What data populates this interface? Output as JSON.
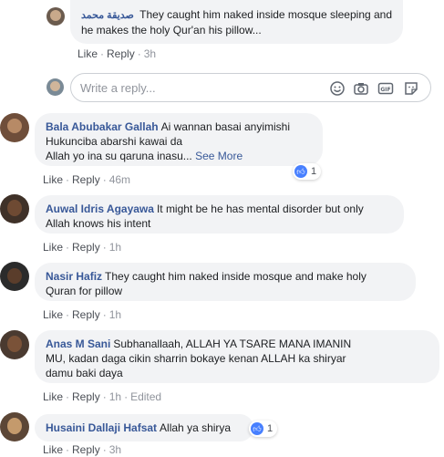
{
  "top_reply": {
    "author": "صديقة محمد",
    "text": "They caught him naked inside mosque sleeping and he makes the holy Qur'an his pillow...",
    "like": "Like",
    "reply": "Reply",
    "time": "3h"
  },
  "composer": {
    "placeholder": "Write a reply...",
    "icons": [
      "emoji-icon",
      "camera-icon",
      "gif-icon",
      "sticker-icon"
    ]
  },
  "comments": [
    {
      "author": "Bala Abubakar Gallah",
      "line1": "Ai wannan basai anyimishi",
      "line2": "Hukunciba abarshi kawai da",
      "line3": "Allah yo ina su qaruna inasu...",
      "see_more": "See More",
      "like": "Like",
      "reply": "Reply",
      "time": "46m",
      "reactions": "1"
    },
    {
      "author": "Auwal Idris Agayawa",
      "line1": "It might be he has mental disorder but only",
      "line2": "Allah knows his intent",
      "like": "Like",
      "reply": "Reply",
      "time": "1h"
    },
    {
      "author": "Nasir Hafiz",
      "line1": "They caught him naked inside mosque and make holy",
      "line2": "Quran for pillow",
      "like": "Like",
      "reply": "Reply",
      "time": "1h"
    },
    {
      "author": "Anas M Sani",
      "line1": "Subhanallaah, ALLAH YA TSARE MANA IMANIN",
      "line2": "MU, kadan daga cikin sharrin bokaye kenan ALLAH ka shiryar",
      "line3": "damu baki daya",
      "like": "Like",
      "reply": "Reply",
      "time": "1h",
      "edited": "Edited"
    },
    {
      "author": "Husaini Dallaji Hafsat",
      "line1": "Allah ya shirya",
      "like": "Like",
      "reply": "Reply",
      "time": "3h",
      "reactions": "1"
    }
  ],
  "colors": {
    "link": "#385898",
    "bubble": "#f2f3f5",
    "meta": "#90949c",
    "like_badge": "#4880ff"
  }
}
